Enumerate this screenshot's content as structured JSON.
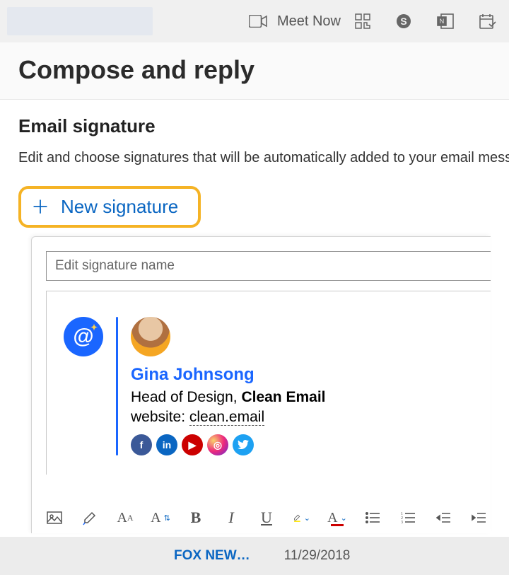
{
  "topbar": {
    "meet_now": "Meet Now"
  },
  "header": {
    "title": "Compose and reply"
  },
  "section": {
    "title": "Email signature",
    "description": "Edit and choose signatures that will be automatically added to your email message"
  },
  "new_signature": {
    "label": "New signature"
  },
  "editor": {
    "name_placeholder": "Edit signature name"
  },
  "signature": {
    "name": "Gina Johnsong",
    "role": "Head of Design,",
    "company": "Clean Email",
    "website_label": "website:",
    "website_value": "clean.email"
  },
  "peek": {
    "headline": "FOX NEW…",
    "date": "11/29/2018"
  }
}
